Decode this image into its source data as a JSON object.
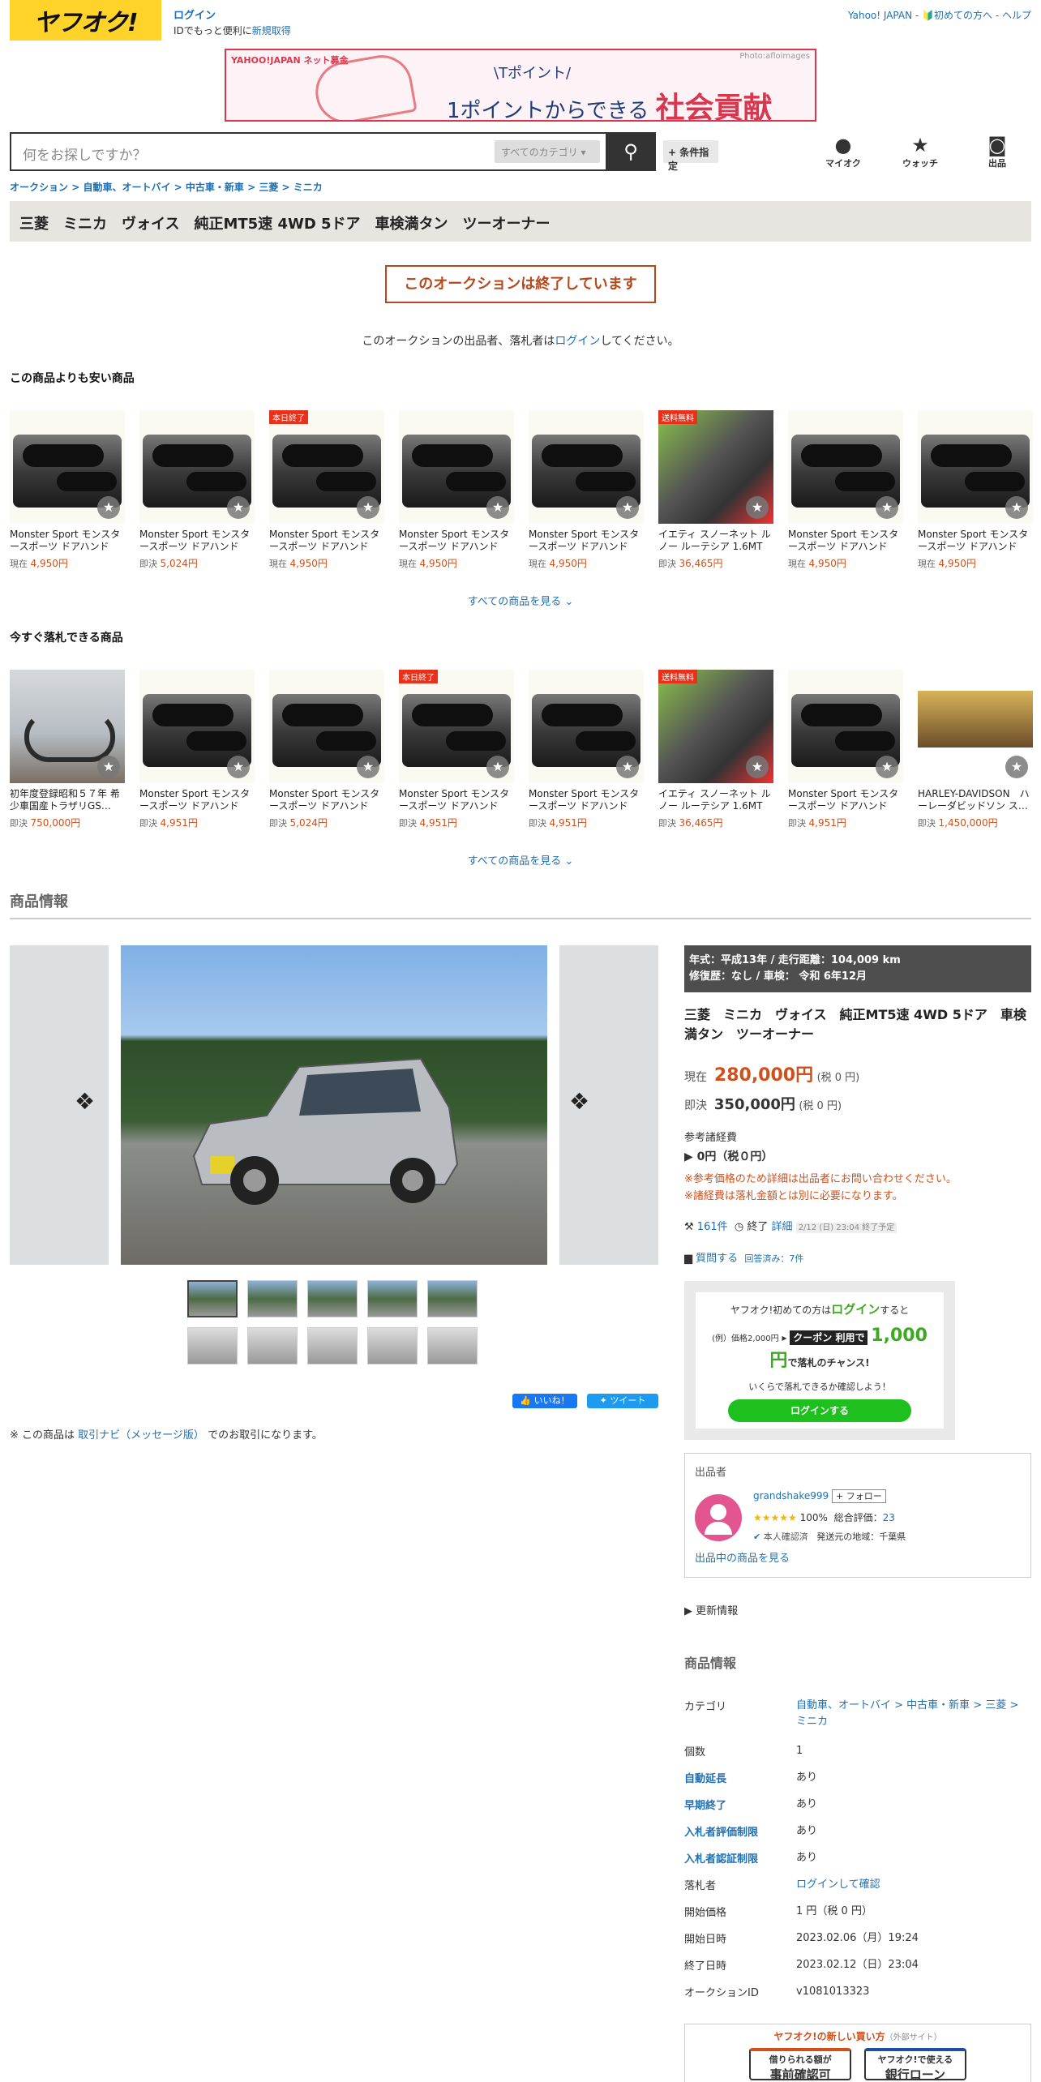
{
  "header": {
    "logo_text": "ヤフオク!",
    "login_label": "ログイン",
    "login_sub": "IDでもっと便利に",
    "signup_label": "新規取得",
    "top_links": [
      "Yahoo! JAPAN",
      "初めての方へ",
      "ヘルプ"
    ]
  },
  "banner": {
    "brand": "YAHOO!JAPAN ネット募金",
    "line1": "\\Tポイント/",
    "line2_a": "1ポイント",
    "line2_b": "からできる",
    "line2_c": "社会貢献",
    "credit": "Photo:afloimages"
  },
  "search": {
    "placeholder": "何をお探しですか？",
    "category": "すべてのカテゴリ",
    "conditions_label": "+ 条件指定"
  },
  "nav_icons": [
    {
      "label": "マイオク",
      "icon": "user-icon"
    },
    {
      "label": "ウォッチ",
      "icon": "star-icon"
    },
    {
      "label": "出品",
      "icon": "camera-icon"
    }
  ],
  "breadcrumb": [
    "オークション",
    "自動車、オートバイ",
    "中古車・新車",
    "三菱",
    "ミニカ"
  ],
  "title": "三菱　ミニカ　ヴォイス　純正MT5速 4WD 5ドア　車検満タン　ツーオーナー",
  "ended_message": "このオークションは終了しています",
  "seller_note": {
    "pre": "このオークションの出品者、落札者は",
    "link": "ログイン",
    "post": "してください。"
  },
  "cheaper": {
    "heading": "この商品よりも安い商品",
    "see_all": "すべての商品を見る",
    "items": [
      {
        "name": "Monster Sport モンスタースポーツ ドアハンドル…",
        "type": "現在",
        "price": "4,950円",
        "badge": "",
        "img": "mirror"
      },
      {
        "name": "Monster Sport モンスタースポーツ ドアハンドル…",
        "type": "即決",
        "price": "5,024円",
        "badge": "",
        "img": "mirror"
      },
      {
        "name": "Monster Sport モンスタースポーツ ドアハンドル…",
        "type": "現在",
        "price": "4,950円",
        "badge": "本日終了",
        "img": "mirror"
      },
      {
        "name": "Monster Sport モンスタースポーツ ドアハンドル…",
        "type": "現在",
        "price": "4,950円",
        "badge": "",
        "img": "mirror"
      },
      {
        "name": "Monster Sport モンスタースポーツ ドアハンドル…",
        "type": "現在",
        "price": "4,950円",
        "badge": "",
        "img": "mirror"
      },
      {
        "name": "イエティ スノーネット ルノー ルーテシア 1.6MT …",
        "type": "即決",
        "price": "36,465円",
        "badge": "送料無料",
        "img": "tire"
      },
      {
        "name": "Monster Sport モンスタースポーツ ドアハンドル…",
        "type": "現在",
        "price": "4,950円",
        "badge": "",
        "img": "mirror"
      },
      {
        "name": "Monster Sport モンスタースポーツ ドアハンドル…",
        "type": "現在",
        "price": "4,950円",
        "badge": "",
        "img": "mirror"
      }
    ]
  },
  "instant": {
    "heading": "今すぐ落札できる商品",
    "see_all": "すべての商品を見る",
    "items": [
      {
        "name": "初年度登録昭和５７年 希少車国産トラザリGS…",
        "type": "即決",
        "price": "750,000円",
        "badge": "",
        "img": "bike"
      },
      {
        "name": "Monster Sport モンスタースポーツ ドアハンドル…",
        "type": "即決",
        "price": "4,951円",
        "badge": "",
        "img": "mirror"
      },
      {
        "name": "Monster Sport モンスタースポーツ ドアハンドル…",
        "type": "即決",
        "price": "5,024円",
        "badge": "",
        "img": "mirror"
      },
      {
        "name": "Monster Sport モンスタースポーツ ドアハンドル…",
        "type": "即決",
        "price": "4,951円",
        "badge": "本日終了",
        "img": "mirror"
      },
      {
        "name": "Monster Sport モンスタースポーツ ドアハンドル…",
        "type": "即決",
        "price": "4,951円",
        "badge": "",
        "img": "mirror"
      },
      {
        "name": "イエティ スノーネット ルノー ルーテシア 1.6MT …",
        "type": "即決",
        "price": "36,465円",
        "badge": "送料無料",
        "img": "tire"
      },
      {
        "name": "Monster Sport モンスタースポーツ ドアハンドル…",
        "type": "即決",
        "price": "4,951円",
        "badge": "",
        "img": "mirror"
      },
      {
        "name": "HARLEY-DAVIDSON　ハーレーダビッドソン ス…",
        "type": "即決",
        "price": "1,450,000円",
        "badge": "",
        "img": "hd"
      }
    ]
  },
  "product_info_heading": "商品情報",
  "specs": {
    "line1": "年式：平成13年  /  走行距離：104,009 km",
    "line2": "修復歴：なし  /  車検：  令和 6年12月"
  },
  "price": {
    "current_label": "現在",
    "current": "280,000円",
    "current_tax": "(税 0 円)",
    "buy_label": "即決",
    "buy": "350,000円",
    "buy_tax": "(税 0 円)",
    "fees_label": "参考諸経費",
    "fees": "0円（税０円）",
    "warn1": "※参考価格のため詳細は出品者にお問い合わせください。",
    "warn2": "※諸経費は落札金額とは別に必要になります。"
  },
  "bids": {
    "count": "161件",
    "end_label": "終了",
    "detail": "詳細",
    "end_note": "2/12 (日) 23:04 終了予定"
  },
  "question": {
    "label": "質問する",
    "answered": "回答済み：7件"
  },
  "promo": {
    "line1": "ヤフオク!初めての方は",
    "login": "ログイン",
    "line1b": "すると",
    "example": "(例）価格2,000円",
    "coupon": "クーポン 利用で",
    "amount": "1,000円",
    "tail": "で落札のチャンス!",
    "check": "いくらで落札できるか確認しよう！",
    "button": "ログインする"
  },
  "seller": {
    "heading": "出品者",
    "name": "grandshake999",
    "follow": "+ フォロー",
    "rating_pct": "100%",
    "rating_label": "総合評価：",
    "rating_count": "23",
    "verified": "本人確認済",
    "area": "発送元の地域：千葉県",
    "list_link": "出品中の商品を見る"
  },
  "update_info": "更新情報",
  "info_table": {
    "heading": "商品情報",
    "rows": [
      {
        "k": "カテゴリ",
        "v": "自動車、オートバイ > 中古車・新車 > 三菱 > ミニカ"
      },
      {
        "k": "個数",
        "v": "1"
      },
      {
        "k": "自動延長",
        "v": "あり"
      },
      {
        "k": "早期終了",
        "v": "あり"
      },
      {
        "k": "入札者評価制限",
        "v": "あり"
      },
      {
        "k": "入札者認証制限",
        "v": "あり"
      },
      {
        "k": "落札者",
        "v": "ログインして確認"
      },
      {
        "k": "開始価格",
        "v": "1 円（税 0 円）"
      },
      {
        "k": "開始日時",
        "v": "2023.02.06（月）19:24"
      },
      {
        "k": "終了日時",
        "v": "2023.02.12（日）23:04"
      },
      {
        "k": "オークションID",
        "v": "v1081013323"
      }
    ]
  },
  "new_buy": {
    "title": "ヤフオク!の新しい買い方",
    "external": "（外部サイト）",
    "btn1_a": "借りられる額が",
    "btn1_b": "事前確認可",
    "btn2_a": "ヤフオク!で使える",
    "btn2_b": "銀行ローン"
  },
  "social": {
    "like": "いいね！",
    "tweet": "ツイート"
  },
  "footer_note": {
    "pre": "※ この商品は",
    "link": "取引ナビ（メッセージ版）",
    "post": "でのお取引になります。"
  },
  "colors": {
    "brand_yellow": "#ffd32a",
    "price_orange": "#d0501c",
    "link_blue": "#1f6fb2",
    "ended_red": "#b5481c"
  }
}
